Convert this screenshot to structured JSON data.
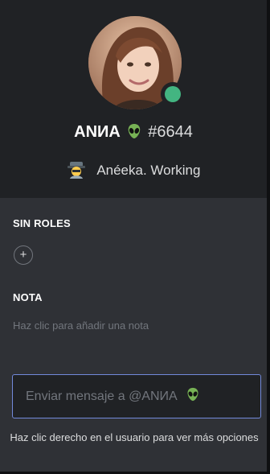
{
  "profile": {
    "username": "ANИA",
    "username_emoji": "alien-icon",
    "discriminator": "#6644",
    "status": "online",
    "status_color": "#43b581",
    "custom_status": {
      "emoji": "detective-icon",
      "text": "Anéeka. Working"
    }
  },
  "roles": {
    "title": "SIN ROLES",
    "add_label": "+"
  },
  "note": {
    "title": "NOTA",
    "placeholder": "Haz clic para añadir una nota"
  },
  "message": {
    "placeholder": "Enviar mensaje a @ANИA",
    "emoji": "alien-icon"
  },
  "hint": "Haz clic derecho en el usuario para ver más opciones",
  "colors": {
    "header_bg": "#202225",
    "body_bg": "#2f3136",
    "accent": "#7289da",
    "online": "#43b581"
  }
}
